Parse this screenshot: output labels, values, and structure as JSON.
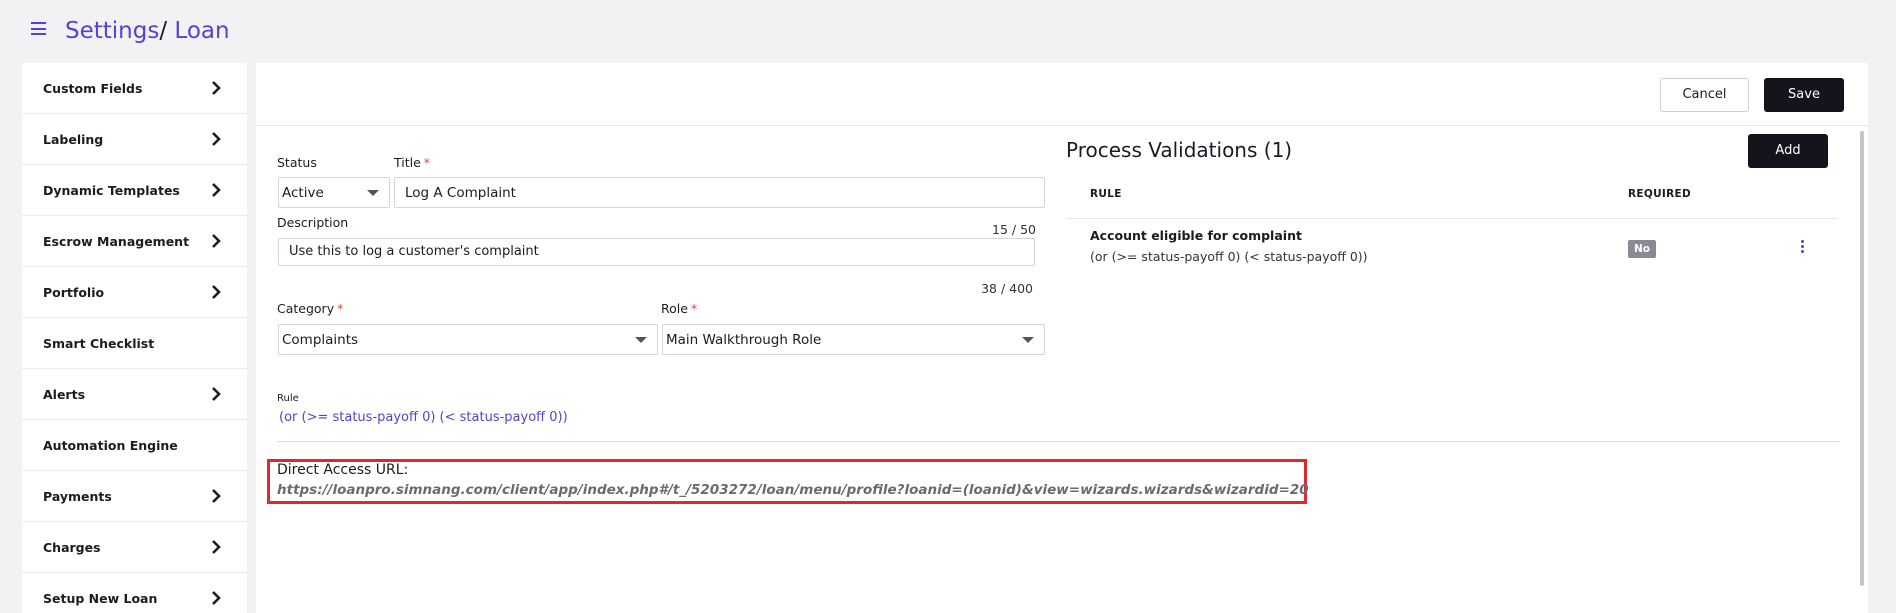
{
  "header": {
    "breadcrumb": [
      {
        "label": "Settings"
      },
      {
        "label": "Loan"
      }
    ],
    "separator": "/"
  },
  "sidebar": {
    "items": [
      {
        "label": "Custom Fields",
        "has_chevron": true
      },
      {
        "label": "Labeling",
        "has_chevron": true
      },
      {
        "label": "Dynamic Templates",
        "has_chevron": true
      },
      {
        "label": "Escrow Management",
        "has_chevron": true
      },
      {
        "label": "Portfolio",
        "has_chevron": true
      },
      {
        "label": "Smart Checklist",
        "has_chevron": false
      },
      {
        "label": "Alerts",
        "has_chevron": true
      },
      {
        "label": "Automation Engine",
        "has_chevron": false
      },
      {
        "label": "Payments",
        "has_chevron": true
      },
      {
        "label": "Charges",
        "has_chevron": true
      },
      {
        "label": "Setup New Loan",
        "has_chevron": true
      }
    ]
  },
  "toolbar": {
    "cancel_label": "Cancel",
    "save_label": "Save"
  },
  "form": {
    "status_label": "Status",
    "status_value": "Active",
    "title_label": "Title",
    "title_value": "Log A Complaint",
    "title_counter": "15 / 50",
    "description_label": "Description",
    "description_value": "Use this to log a customer's complaint",
    "description_counter": "38 / 400",
    "category_label": "Category",
    "category_value": "Complaints",
    "role_label": "Role",
    "role_value": "Main Walkthrough Role",
    "rule_label": "Rule",
    "rule_value": "(or (>= status-payoff 0) (< status-payoff 0))",
    "required_mark": "*"
  },
  "direct_access": {
    "label": "Direct Access URL:",
    "url": "https://loanpro.simnang.com/client/app/index.php#/t_/5203272/loan/menu/profile?loanid=(loanid)&view=wizards.wizards&wizardid=20"
  },
  "validations": {
    "title": "Process Validations (1)",
    "add_label": "Add",
    "columns": [
      "RULE",
      "REQUIRED"
    ],
    "rows": [
      {
        "name": "Account eligible for complaint",
        "rule": "(or (>= status-payoff 0) (< status-payoff 0))",
        "required": "No"
      }
    ]
  },
  "colors": {
    "accent": "#5a3fd6",
    "primary_button": "#14141c",
    "highlight_border": "#e3262e",
    "badge_gray": "#8a8a92"
  }
}
